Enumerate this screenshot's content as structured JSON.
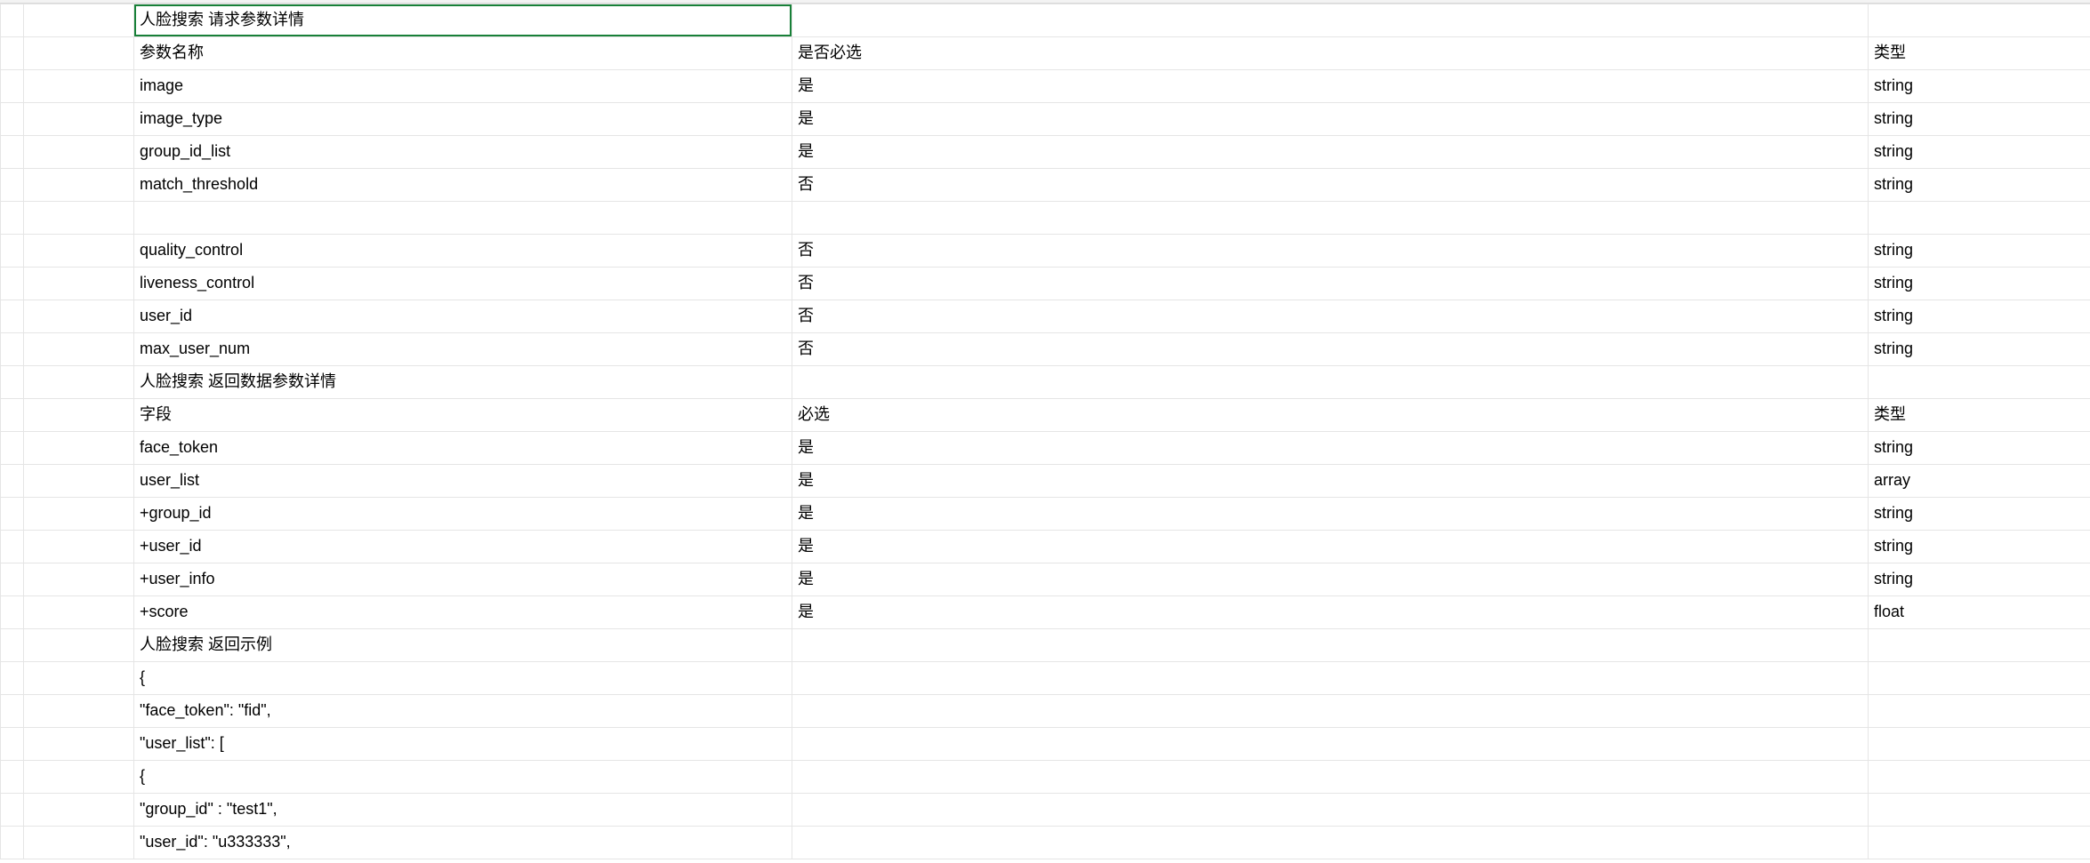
{
  "rows": [
    {
      "a": "",
      "b": "人脸搜索 请求参数详情",
      "c": "",
      "d": ""
    },
    {
      "a": "",
      "b": "参数名称",
      "c": "是否必选",
      "d": "类型"
    },
    {
      "a": "",
      "b": "image",
      "c": "是",
      "d": "string"
    },
    {
      "a": "",
      "b": "image_type",
      "c": "是",
      "d": "string"
    },
    {
      "a": "",
      "b": "group_id_list",
      "c": "是",
      "d": "string"
    },
    {
      "a": "",
      "b": "match_threshold",
      "c": "否",
      "d": "string"
    },
    {
      "a": "",
      "b": "",
      "c": "",
      "d": ""
    },
    {
      "a": "",
      "b": "quality_control",
      "c": "否",
      "d": "string"
    },
    {
      "a": "",
      "b": "liveness_control",
      "c": "否",
      "d": "string"
    },
    {
      "a": "",
      "b": "user_id",
      "c": "否",
      "d": "string"
    },
    {
      "a": "",
      "b": "max_user_num",
      "c": "否",
      "d": "string"
    },
    {
      "a": "",
      "b": "人脸搜索 返回数据参数详情",
      "c": "",
      "d": ""
    },
    {
      "a": "",
      "b": "字段",
      "c": "必选",
      "d": "类型"
    },
    {
      "a": "",
      "b": "face_token",
      "c": "是",
      "d": "string"
    },
    {
      "a": "",
      "b": "user_list",
      "c": "是",
      "d": "array"
    },
    {
      "a": "",
      "b": "+group_id",
      "c": "是",
      "d": "string"
    },
    {
      "a": "",
      "b": "+user_id",
      "c": "是",
      "d": "string"
    },
    {
      "a": "",
      "b": "+user_info",
      "c": "是",
      "d": "string"
    },
    {
      "a": "",
      "b": "+score",
      "c": "是",
      "d": "float"
    },
    {
      "a": "",
      "b": "人脸搜索 返回示例",
      "c": "",
      "d": ""
    },
    {
      "a": "",
      "b": "{",
      "c": "",
      "d": ""
    },
    {
      "a": "",
      "b": "\"face_token\": \"fid\",",
      "c": "",
      "d": ""
    },
    {
      "a": "",
      "b": "\"user_list\": [",
      "c": "",
      "d": ""
    },
    {
      "a": "",
      "b": "{",
      "c": "",
      "d": ""
    },
    {
      "a": "",
      "b": "\"group_id\" : \"test1\",",
      "c": "",
      "d": ""
    },
    {
      "a": "",
      "b": "\"user_id\": \"u333333\",",
      "c": "",
      "d": ""
    }
  ],
  "selected_row_index": 0
}
